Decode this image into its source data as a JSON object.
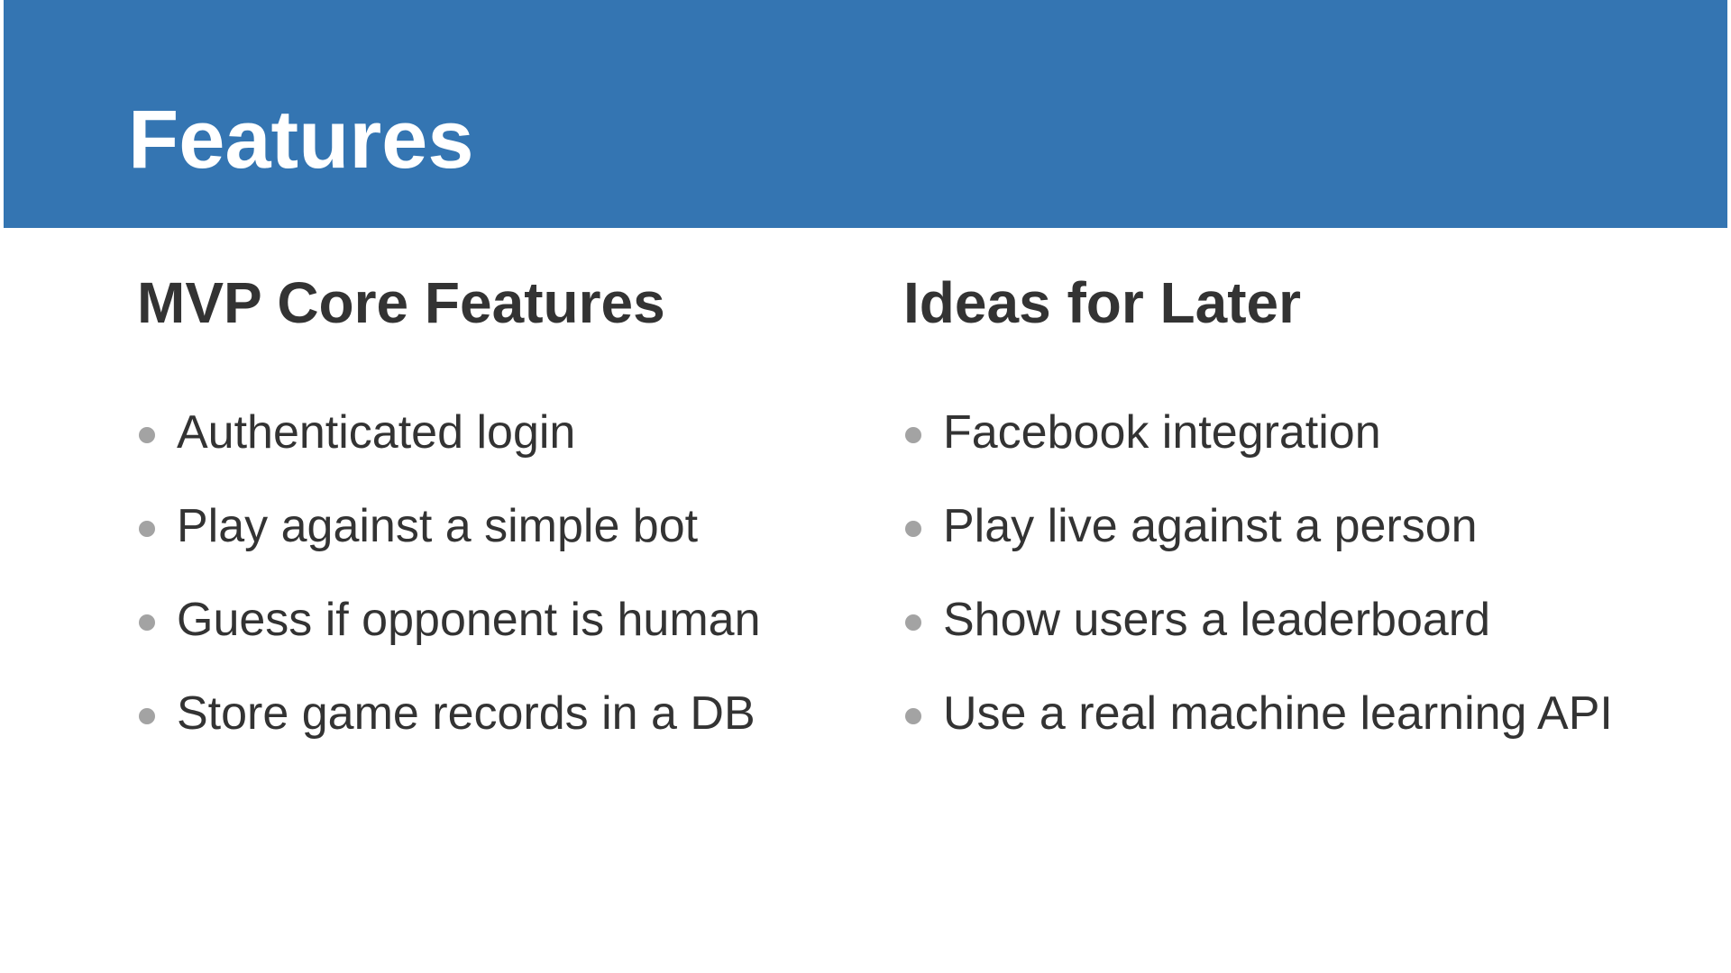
{
  "slide": {
    "title": "Features",
    "accent_color": "#3475b2",
    "bullet_color": "#a3a3a3",
    "text_color": "#333333"
  },
  "columns": {
    "left": {
      "heading": "MVP Core Features",
      "items": [
        {
          "label": "Authenticated login"
        },
        {
          "label": "Play against a simple bot"
        },
        {
          "label": "Guess if opponent is human"
        },
        {
          "label": "Store game records in a DB"
        }
      ]
    },
    "right": {
      "heading": "Ideas for Later",
      "items": [
        {
          "label": "Facebook integration"
        },
        {
          "label": "Play live against a person"
        },
        {
          "label": "Show users a leaderboard"
        },
        {
          "label": "Use a real machine learning API"
        }
      ]
    }
  }
}
